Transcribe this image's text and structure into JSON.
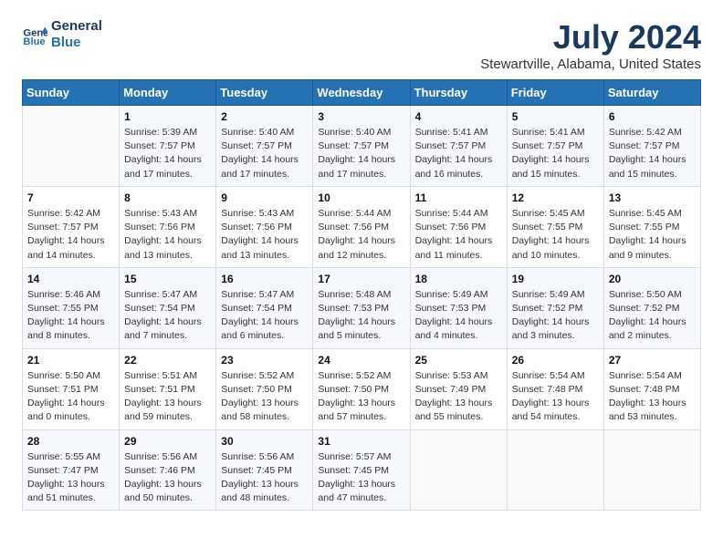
{
  "header": {
    "logo_line1": "General",
    "logo_line2": "Blue",
    "title": "July 2024",
    "subtitle": "Stewartville, Alabama, United States"
  },
  "calendar": {
    "headers": [
      "Sunday",
      "Monday",
      "Tuesday",
      "Wednesday",
      "Thursday",
      "Friday",
      "Saturday"
    ],
    "weeks": [
      [
        {
          "day": "",
          "info": ""
        },
        {
          "day": "1",
          "info": "Sunrise: 5:39 AM\nSunset: 7:57 PM\nDaylight: 14 hours\nand 17 minutes."
        },
        {
          "day": "2",
          "info": "Sunrise: 5:40 AM\nSunset: 7:57 PM\nDaylight: 14 hours\nand 17 minutes."
        },
        {
          "day": "3",
          "info": "Sunrise: 5:40 AM\nSunset: 7:57 PM\nDaylight: 14 hours\nand 17 minutes."
        },
        {
          "day": "4",
          "info": "Sunrise: 5:41 AM\nSunset: 7:57 PM\nDaylight: 14 hours\nand 16 minutes."
        },
        {
          "day": "5",
          "info": "Sunrise: 5:41 AM\nSunset: 7:57 PM\nDaylight: 14 hours\nand 15 minutes."
        },
        {
          "day": "6",
          "info": "Sunrise: 5:42 AM\nSunset: 7:57 PM\nDaylight: 14 hours\nand 15 minutes."
        }
      ],
      [
        {
          "day": "7",
          "info": "Sunrise: 5:42 AM\nSunset: 7:57 PM\nDaylight: 14 hours\nand 14 minutes."
        },
        {
          "day": "8",
          "info": "Sunrise: 5:43 AM\nSunset: 7:56 PM\nDaylight: 14 hours\nand 13 minutes."
        },
        {
          "day": "9",
          "info": "Sunrise: 5:43 AM\nSunset: 7:56 PM\nDaylight: 14 hours\nand 13 minutes."
        },
        {
          "day": "10",
          "info": "Sunrise: 5:44 AM\nSunset: 7:56 PM\nDaylight: 14 hours\nand 12 minutes."
        },
        {
          "day": "11",
          "info": "Sunrise: 5:44 AM\nSunset: 7:56 PM\nDaylight: 14 hours\nand 11 minutes."
        },
        {
          "day": "12",
          "info": "Sunrise: 5:45 AM\nSunset: 7:55 PM\nDaylight: 14 hours\nand 10 minutes."
        },
        {
          "day": "13",
          "info": "Sunrise: 5:45 AM\nSunset: 7:55 PM\nDaylight: 14 hours\nand 9 minutes."
        }
      ],
      [
        {
          "day": "14",
          "info": "Sunrise: 5:46 AM\nSunset: 7:55 PM\nDaylight: 14 hours\nand 8 minutes."
        },
        {
          "day": "15",
          "info": "Sunrise: 5:47 AM\nSunset: 7:54 PM\nDaylight: 14 hours\nand 7 minutes."
        },
        {
          "day": "16",
          "info": "Sunrise: 5:47 AM\nSunset: 7:54 PM\nDaylight: 14 hours\nand 6 minutes."
        },
        {
          "day": "17",
          "info": "Sunrise: 5:48 AM\nSunset: 7:53 PM\nDaylight: 14 hours\nand 5 minutes."
        },
        {
          "day": "18",
          "info": "Sunrise: 5:49 AM\nSunset: 7:53 PM\nDaylight: 14 hours\nand 4 minutes."
        },
        {
          "day": "19",
          "info": "Sunrise: 5:49 AM\nSunset: 7:52 PM\nDaylight: 14 hours\nand 3 minutes."
        },
        {
          "day": "20",
          "info": "Sunrise: 5:50 AM\nSunset: 7:52 PM\nDaylight: 14 hours\nand 2 minutes."
        }
      ],
      [
        {
          "day": "21",
          "info": "Sunrise: 5:50 AM\nSunset: 7:51 PM\nDaylight: 14 hours\nand 0 minutes."
        },
        {
          "day": "22",
          "info": "Sunrise: 5:51 AM\nSunset: 7:51 PM\nDaylight: 13 hours\nand 59 minutes."
        },
        {
          "day": "23",
          "info": "Sunrise: 5:52 AM\nSunset: 7:50 PM\nDaylight: 13 hours\nand 58 minutes."
        },
        {
          "day": "24",
          "info": "Sunrise: 5:52 AM\nSunset: 7:50 PM\nDaylight: 13 hours\nand 57 minutes."
        },
        {
          "day": "25",
          "info": "Sunrise: 5:53 AM\nSunset: 7:49 PM\nDaylight: 13 hours\nand 55 minutes."
        },
        {
          "day": "26",
          "info": "Sunrise: 5:54 AM\nSunset: 7:48 PM\nDaylight: 13 hours\nand 54 minutes."
        },
        {
          "day": "27",
          "info": "Sunrise: 5:54 AM\nSunset: 7:48 PM\nDaylight: 13 hours\nand 53 minutes."
        }
      ],
      [
        {
          "day": "28",
          "info": "Sunrise: 5:55 AM\nSunset: 7:47 PM\nDaylight: 13 hours\nand 51 minutes."
        },
        {
          "day": "29",
          "info": "Sunrise: 5:56 AM\nSunset: 7:46 PM\nDaylight: 13 hours\nand 50 minutes."
        },
        {
          "day": "30",
          "info": "Sunrise: 5:56 AM\nSunset: 7:45 PM\nDaylight: 13 hours\nand 48 minutes."
        },
        {
          "day": "31",
          "info": "Sunrise: 5:57 AM\nSunset: 7:45 PM\nDaylight: 13 hours\nand 47 minutes."
        },
        {
          "day": "",
          "info": ""
        },
        {
          "day": "",
          "info": ""
        },
        {
          "day": "",
          "info": ""
        }
      ]
    ]
  }
}
